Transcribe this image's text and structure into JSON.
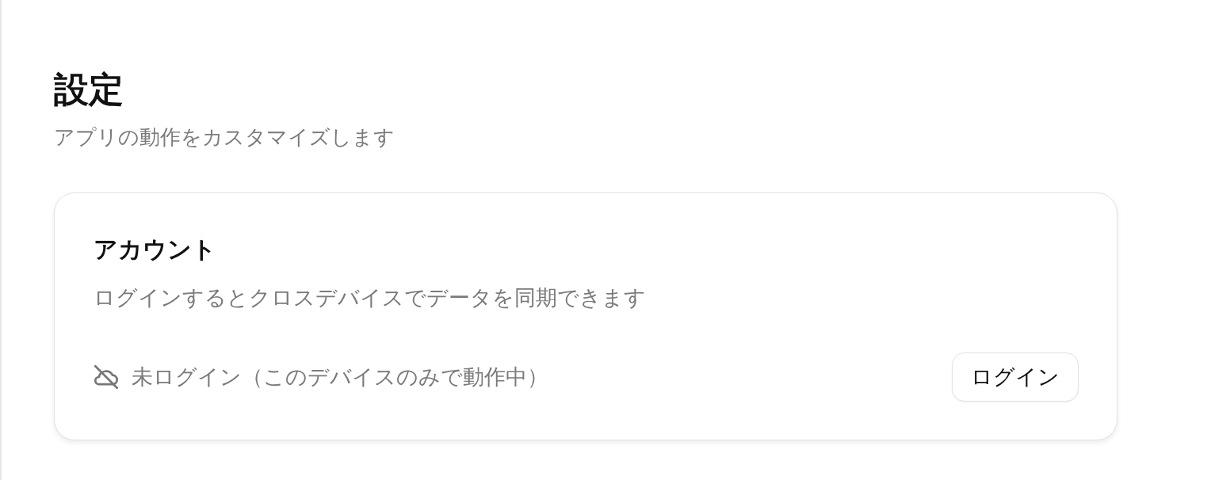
{
  "page": {
    "title": "設定",
    "subtitle": "アプリの動作をカスタマイズします"
  },
  "account_card": {
    "title": "アカウント",
    "description": "ログインするとクロスデバイスでデータを同期できます",
    "status": {
      "logged_in": false,
      "text": "未ログイン（このデバイスのみで動作中）"
    },
    "button": {
      "label": "ログイン"
    }
  }
}
